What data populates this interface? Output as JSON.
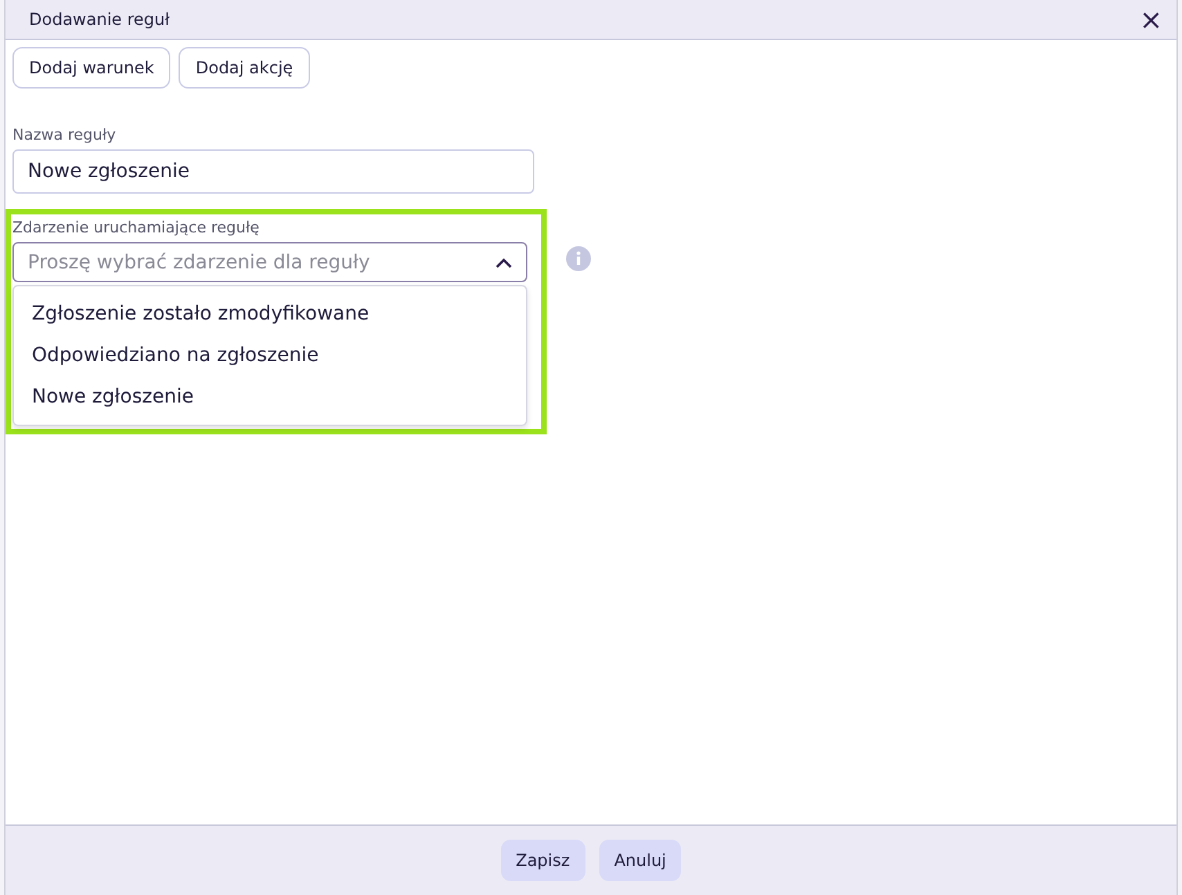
{
  "window": {
    "title": "Dodawanie reguł",
    "close": "×"
  },
  "toolbar": [
    "Dodaj warunek",
    "Dodaj akcję"
  ],
  "rule_name": {
    "label": "Nazwa reguły",
    "value": "Nowe zgłoszenie"
  },
  "trigger": {
    "label": "Zdarzenie uruchamiające regułę",
    "placeholder": "Proszę wybrać zdarzenie dla reguły",
    "expanded": true,
    "highlighted": true,
    "options": [
      {
        "label": "Zgłoszenie zostało zmodyfikowane",
        "selected": false
      },
      {
        "label": "Odpowiedziano na zgłoszenie",
        "selected": false
      },
      {
        "label": "Nowe zgłoszenie",
        "selected": false
      }
    ]
  },
  "footer": [
    "Zapisz",
    "Anuluj"
  ]
}
